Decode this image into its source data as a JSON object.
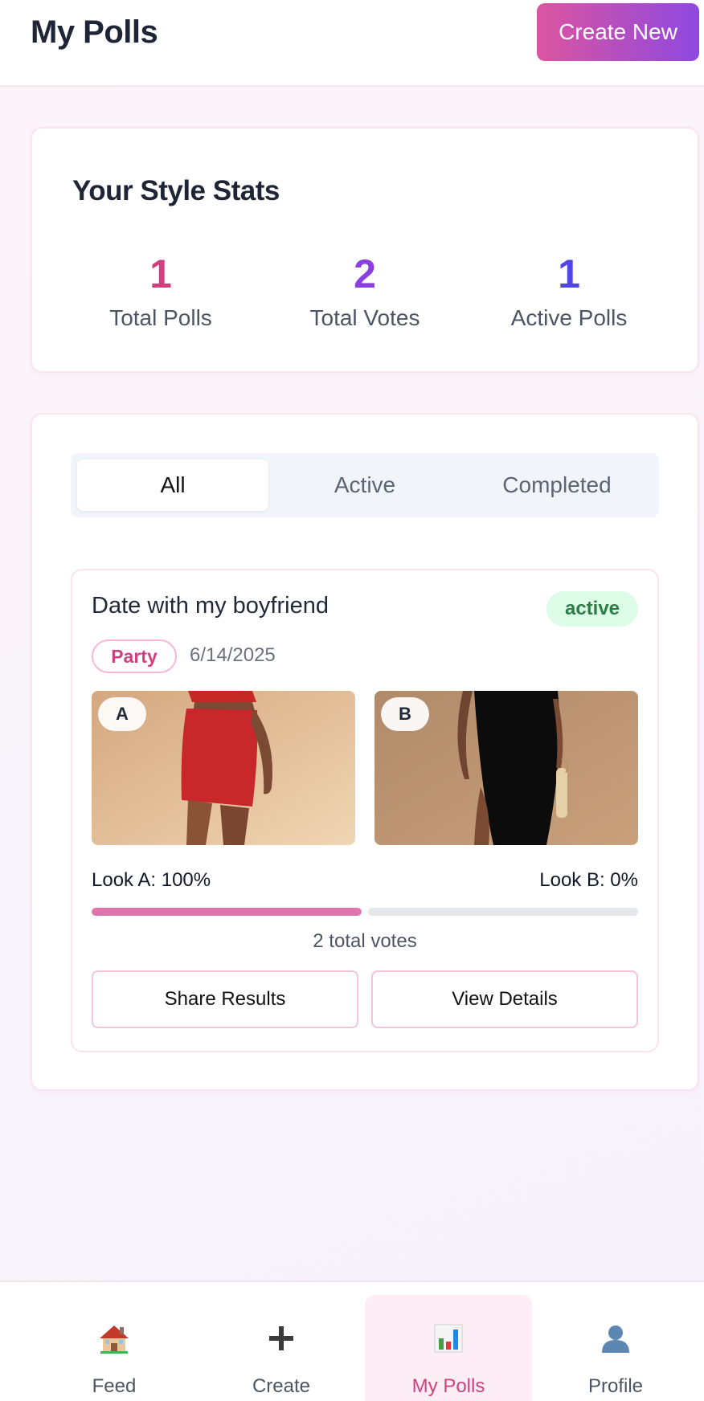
{
  "header": {
    "title": "My Polls",
    "create_button": "Create New"
  },
  "stats": {
    "title": "Your Style Stats",
    "items": [
      {
        "value": "1",
        "label": "Total Polls",
        "color": "#d0407f"
      },
      {
        "value": "2",
        "label": "Total Votes",
        "color": "#8b3fe0"
      },
      {
        "value": "1",
        "label": "Active Polls",
        "color": "#4f46e5"
      }
    ]
  },
  "tabs": [
    {
      "label": "All",
      "active": true
    },
    {
      "label": "Active",
      "active": false
    },
    {
      "label": "Completed",
      "active": false
    }
  ],
  "poll": {
    "title": "Date with my boyfriend",
    "status": "active",
    "category": "Party",
    "date": "6/14/2025",
    "look_a": {
      "tag": "A",
      "label": "Look A: 100%",
      "percent": 100
    },
    "look_b": {
      "tag": "B",
      "label": "Look B: 0%",
      "percent": 0
    },
    "total_votes": "2 total votes",
    "share_button": "Share Results",
    "details_button": "View Details"
  },
  "nav": [
    {
      "label": "Feed",
      "icon": "house-icon",
      "active": false
    },
    {
      "label": "Create",
      "icon": "plus-icon",
      "active": false
    },
    {
      "label": "My Polls",
      "icon": "bar-chart-icon",
      "active": true
    },
    {
      "label": "Profile",
      "icon": "user-silhouette-icon",
      "active": false
    }
  ],
  "colors": {
    "accent_pink": "#d0407f",
    "gradient_start": "#dc55a0",
    "gradient_end": "#8e48e0",
    "active_badge_bg": "#dcfce7",
    "active_badge_text": "#2e7d45",
    "progress_fill": "#e074ac"
  }
}
